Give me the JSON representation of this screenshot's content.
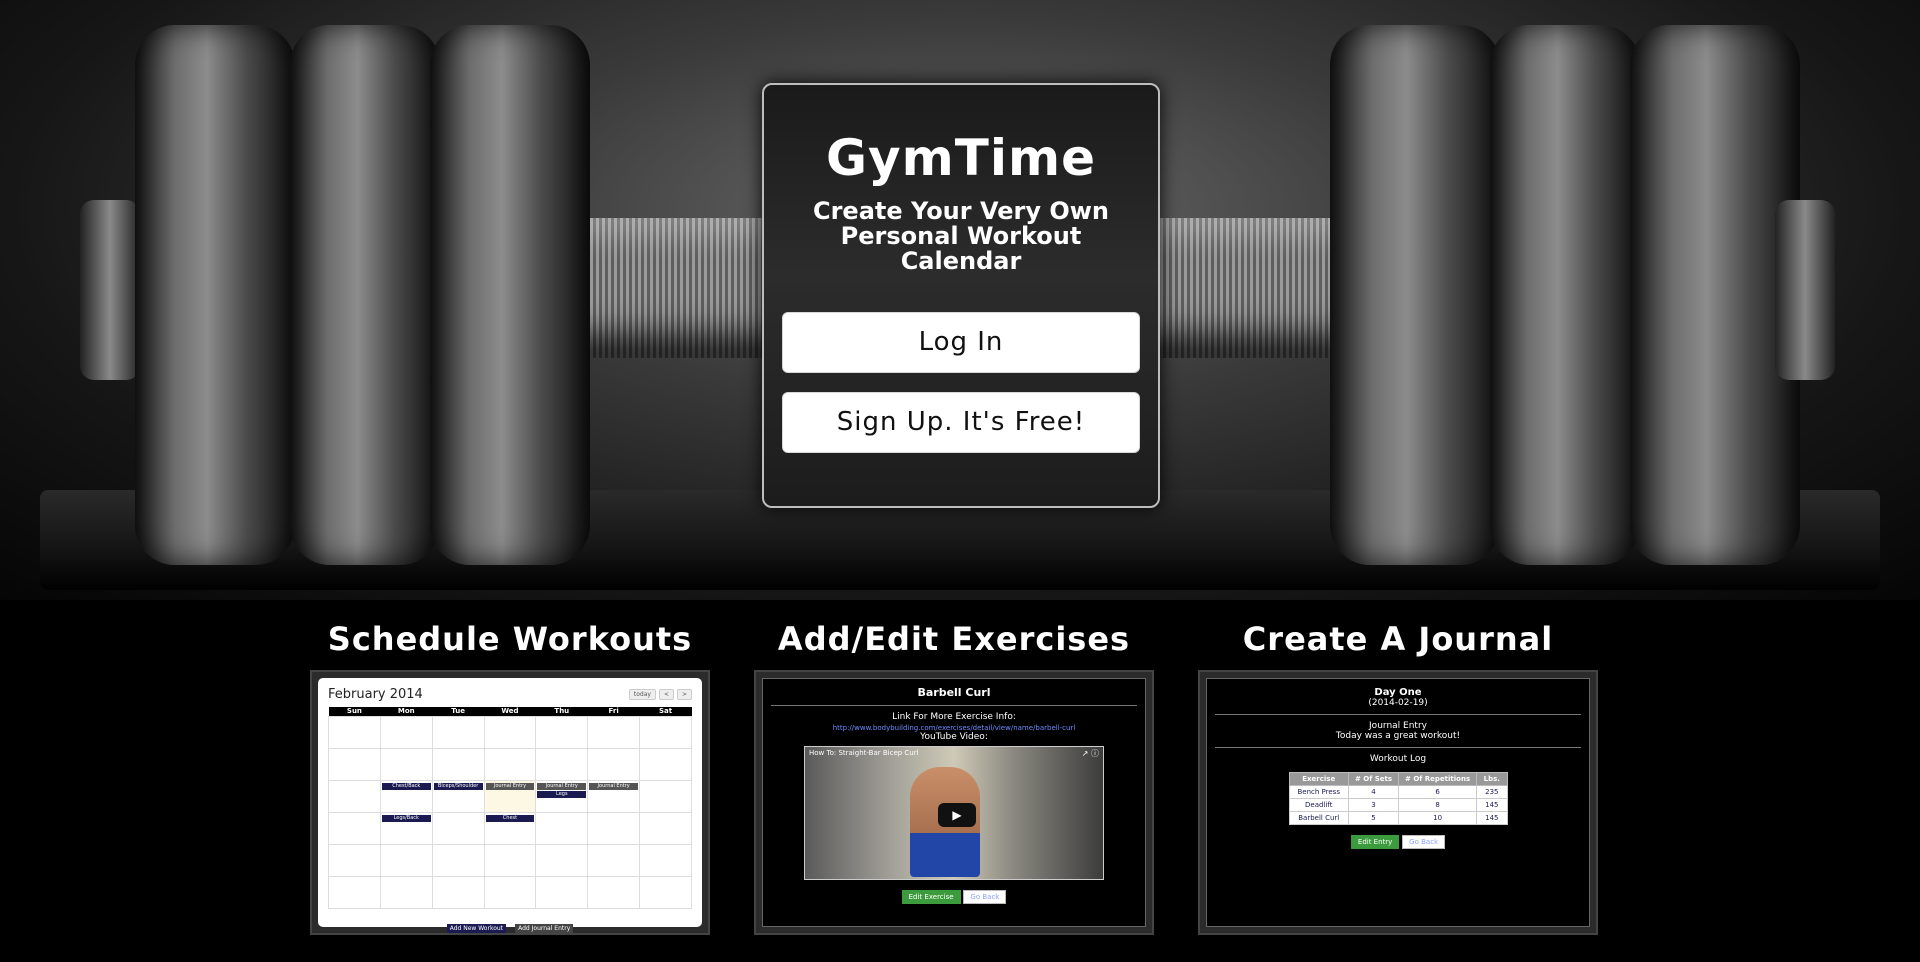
{
  "hero": {
    "app_title": "GymTime",
    "tagline": "Create Your Very Own Personal Workout Calendar",
    "login_label": "Log In",
    "signup_label": "Sign Up. It's Free!"
  },
  "features": [
    {
      "heading": "Schedule Workouts",
      "calendar": {
        "month_title": "February 2014",
        "today_label": "today",
        "prev_label": "<",
        "next_label": ">",
        "weekdays": [
          "Sun",
          "Mon",
          "Tue",
          "Wed",
          "Thu",
          "Fri",
          "Sat"
        ],
        "events": {
          "ev1": "Chest/Back",
          "ev2": "Biceps/Shoulder",
          "ev3": "Journal Entry",
          "ev4": "Journal Entry",
          "ev5": "Legs",
          "ev6": "Journal Entry",
          "ev7": "Legs/Back",
          "ev8": "Chest"
        },
        "add_workout_label": "Add New Workout",
        "add_journal_label": "Add Journal Entry"
      }
    },
    {
      "heading": "Add/Edit Exercises",
      "exercise": {
        "name": "Barbell Curl",
        "link_heading": "Link For More Exercise Info:",
        "link_url": "http://www.bodybuilding.com/exercises/detail/view/name/barbell-curl",
        "video_heading": "YouTube Video:",
        "video_title": "How To: Straight-Bar Bicep Curl",
        "edit_label": "Edit Exercise",
        "back_label": "Go Back"
      }
    },
    {
      "heading": "Create A Journal",
      "journal": {
        "day_title": "Day One",
        "date": "(2014-02-19)",
        "entry_heading": "Journal Entry",
        "entry_text": "Today was a great workout!",
        "log_heading": "Workout Log",
        "columns": [
          "Exercise",
          "# Of Sets",
          "# Of Repetitions",
          "Lbs."
        ],
        "rows": [
          [
            "Bench Press",
            "4",
            "6",
            "235"
          ],
          [
            "Deadlift",
            "3",
            "8",
            "145"
          ],
          [
            "Barbell Curl",
            "5",
            "10",
            "145"
          ]
        ],
        "edit_label": "Edit Entry",
        "back_label": "Go Back"
      }
    }
  ]
}
